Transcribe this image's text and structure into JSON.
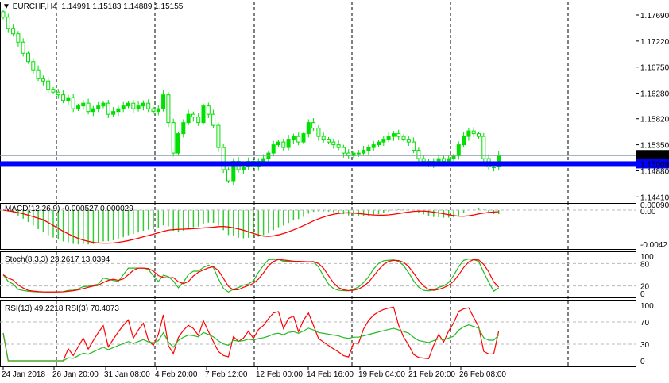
{
  "header": {
    "symbol": "EURCHF,H4",
    "open": "1.14991",
    "high": "1.15183",
    "low": "1.14889",
    "close": "1.15155"
  },
  "chart_data": {
    "type": "candlestick",
    "symbol": "EURCHF",
    "timeframe": "H4",
    "price_ticks": [
      "1.17690",
      "1.17220",
      "1.16750",
      "1.16280",
      "1.15820",
      "1.15350",
      "1.14880",
      "1.14410"
    ],
    "price_range": [
      1.1441,
      1.1769
    ],
    "bid_label": "1.15155",
    "bid": 1.15155,
    "hline_label": "1.15009",
    "hline": 1.15009,
    "date_labels": [
      "24 Jan 2018",
      "26 Jan 20:00",
      "31 Jan 08:00",
      "4 Feb 20:00",
      "7 Feb 12:00",
      "12 Feb 00:00",
      "14 Feb 16:00",
      "19 Feb 04:00",
      "21 Feb 20:00",
      "26 Feb 08:00"
    ],
    "closes": [
      1.1765,
      1.1745,
      1.1735,
      1.172,
      1.17,
      1.1685,
      1.167,
      1.1655,
      1.165,
      1.1635,
      1.163,
      1.1625,
      1.1615,
      1.162,
      1.16,
      1.1605,
      1.161,
      1.1595,
      1.16,
      1.1605,
      1.161,
      1.159,
      1.1595,
      1.16,
      1.1605,
      1.161,
      1.16,
      1.1605,
      1.161,
      1.16,
      1.1595,
      1.16,
      1.1625,
      1.1575,
      1.152,
      1.1555,
      1.1575,
      1.159,
      1.1585,
      1.1575,
      1.1605,
      1.159,
      1.157,
      1.153,
      1.149,
      1.147,
      1.1505,
      1.149,
      1.1495,
      1.1505,
      1.1495,
      1.1505,
      1.151,
      1.152,
      1.1535,
      1.154,
      1.153,
      1.1545,
      1.155,
      1.154,
      1.1555,
      1.1575,
      1.1565,
      1.155,
      1.1545,
      1.154,
      1.1535,
      1.153,
      1.152,
      1.1515,
      1.152,
      1.152,
      1.1525,
      1.153,
      1.1535,
      1.154,
      1.1545,
      1.155,
      1.1555,
      1.155,
      1.1545,
      1.154,
      1.1525,
      1.151,
      1.1505,
      1.15,
      1.1505,
      1.151,
      1.1505,
      1.151,
      1.1515,
      1.1535,
      1.155,
      1.156,
      1.1555,
      1.155,
      1.151,
      1.1495,
      1.1495,
      1.1516
    ],
    "macd": {
      "label": "MACD(12,26,9) -0.000527 0.000029",
      "ticks": [
        "0.000901",
        "0.00",
        "-0.0042"
      ],
      "range": [
        -0.0042,
        0.000901
      ]
    },
    "stoch": {
      "label": "Stoch(8,3,3) 23.2617 13.0394",
      "ticks": [
        "100",
        "80",
        "20",
        "0"
      ],
      "levels": [
        80,
        20
      ]
    },
    "rsi": {
      "label": "RSI(13) 49.2218  RSI(3) 70.4073",
      "ticks": [
        "100",
        "70",
        "30",
        "0"
      ],
      "levels": [
        70,
        30
      ]
    }
  },
  "colors": {
    "candle": "#00e000",
    "hline": "#0000ff",
    "macd_hist": "#33cc33",
    "signal": "#ff0000",
    "grid": "#000000"
  }
}
